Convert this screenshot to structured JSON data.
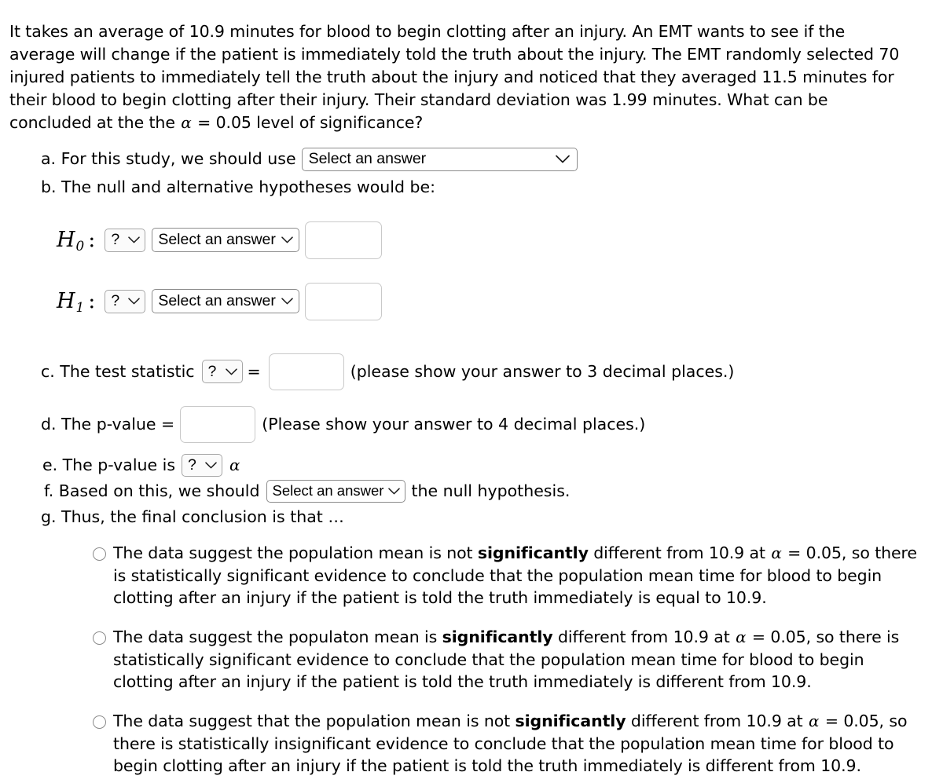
{
  "problem": {
    "text_part1": "It takes an average of 10.9 minutes for blood to begin clotting after an injury.  An EMT wants to see if the average will change if the patient is immediately told the truth about the injury. The EMT randomly selected 70 injured patients to immediately tell the truth about the injury and noticed that they averaged 11.5 minutes for their blood to begin clotting after their injury. Their standard deviation was 1.99 minutes. What can be concluded at the the ",
    "alpha_symbol": "α",
    "text_part2": " = 0.05 level of significance?",
    "population_mean": "10.9",
    "sample_size": "70",
    "sample_mean": "11.5",
    "standard_deviation": "1.99",
    "alpha_level": "0.05"
  },
  "items": {
    "a": {
      "label": "a. For this study, we should use",
      "select_value": "Select an answer",
      "chevron": "chevron-down-icon"
    },
    "b": {
      "label": "b. The null and alternative hypotheses would be:"
    },
    "h0": {
      "symbol": "H",
      "subscript": "0",
      "colon": ":",
      "operator_select": "?",
      "answer_select": "Select an answer",
      "value_input": ""
    },
    "h1": {
      "symbol": "H",
      "subscript": "1",
      "colon": ":",
      "operator_select": "?",
      "answer_select": "Select an answer",
      "value_input": ""
    },
    "c": {
      "label": "c. The test statistic",
      "stat_select": "?",
      "equals": "=",
      "value_input": "",
      "hint": "(please show your answer to 3 decimal places.)"
    },
    "d": {
      "label": "d. The p-value =",
      "value_input": "",
      "hint": "(Please show your answer to 4 decimal places.)"
    },
    "e": {
      "label": "e. The p-value is",
      "compare_select": "?",
      "alpha_symbol": "α"
    },
    "f": {
      "label_before": "f. Based on this, we should",
      "action_select": "Select an answer",
      "label_after": "the null hypothesis."
    },
    "g": {
      "label": "g. Thus, the final conclusion is that …"
    }
  },
  "choices": [
    {
      "id": "choice-1",
      "selected": false,
      "segments": [
        {
          "text": "The data suggest the population mean is not ",
          "bold": false
        },
        {
          "text": "significantly",
          "bold": true
        },
        {
          "text": " different from 10.9 at ",
          "bold": false
        },
        {
          "text": "α",
          "bold": false,
          "math": true
        },
        {
          "text": " = 0.05, so there is statistically significant evidence to conclude that the population mean time for blood to begin clotting after an injury if the patient is told the truth immediately is equal to 10.9.",
          "bold": false
        }
      ]
    },
    {
      "id": "choice-2",
      "selected": false,
      "segments": [
        {
          "text": "The data suggest the populaton mean is ",
          "bold": false
        },
        {
          "text": "significantly",
          "bold": true
        },
        {
          "text": " different from 10.9 at ",
          "bold": false
        },
        {
          "text": "α",
          "bold": false,
          "math": true
        },
        {
          "text": " = 0.05, so there is statistically significant evidence to conclude that the population mean time for blood to begin clotting after an injury if the patient is told the truth immediately is different from 10.9.",
          "bold": false
        }
      ]
    },
    {
      "id": "choice-3",
      "selected": false,
      "segments": [
        {
          "text": "The data suggest that the population mean is not ",
          "bold": false
        },
        {
          "text": "significantly",
          "bold": true
        },
        {
          "text": " different from 10.9 at ",
          "bold": false
        },
        {
          "text": "α",
          "bold": false,
          "math": true
        },
        {
          "text": " = 0.05, so there is statistically insignificant evidence to conclude that the population mean time for blood to begin clotting after an injury if the patient is told the truth immediately is different from 10.9.",
          "bold": false
        }
      ]
    }
  ],
  "colors": {
    "text": "#000000",
    "background": "#ffffff",
    "input_border": "#c9c9c9",
    "select_border": "#8c8c8c",
    "radio_border": "#8a8a8a"
  }
}
